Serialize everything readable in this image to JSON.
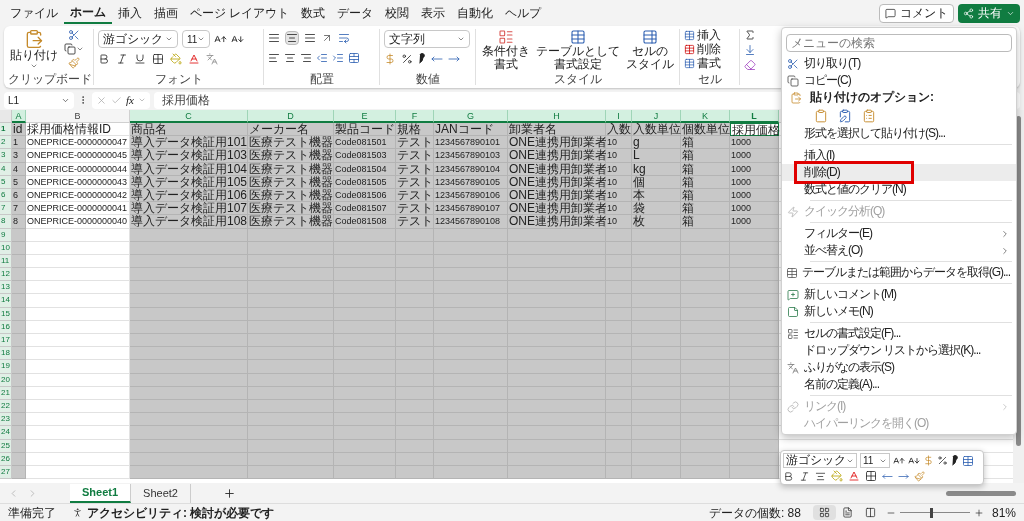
{
  "ribbon_tabs": [
    {
      "label": "ファイル",
      "selected": false
    },
    {
      "label": "ホーム",
      "selected": true
    },
    {
      "label": "挿入",
      "selected": false
    },
    {
      "label": "描画",
      "selected": false
    },
    {
      "label": "ページ レイアウト",
      "selected": false
    },
    {
      "label": "数式",
      "selected": false
    },
    {
      "label": "データ",
      "selected": false
    },
    {
      "label": "校閲",
      "selected": false
    },
    {
      "label": "表示",
      "selected": false
    },
    {
      "label": "自動化",
      "selected": false
    },
    {
      "label": "ヘルプ",
      "selected": false
    }
  ],
  "header_buttons": {
    "comment": "コメント",
    "share": "共有"
  },
  "ribbon": {
    "clipboard": {
      "paste": "貼り付け",
      "label": "クリップボード"
    },
    "font": {
      "name": "游ゴシック",
      "size": "11",
      "label": "フォント"
    },
    "alignment": {
      "label": "配置"
    },
    "number": {
      "format": "文字列",
      "label": "数値"
    },
    "styles": {
      "buttons": [
        [
          "条件付き",
          "書式"
        ],
        [
          "テーブルとして",
          "書式設定"
        ],
        [
          "セルの",
          "スタイル"
        ]
      ],
      "label": "スタイル"
    },
    "cells": {
      "buttons": [
        "挿入",
        "削除",
        "書式"
      ],
      "label": "セル"
    }
  },
  "formula_bar": {
    "name_box": "L1",
    "fx": "fx",
    "content": "採用価格"
  },
  "sheet": {
    "columns": [
      {
        "label": "A",
        "selected": true,
        "active": false
      },
      {
        "label": "B",
        "selected": false,
        "active": false
      },
      {
        "label": "C",
        "selected": true,
        "active": false
      },
      {
        "label": "D",
        "selected": true,
        "active": false
      },
      {
        "label": "E",
        "selected": true,
        "active": false
      },
      {
        "label": "F",
        "selected": true,
        "active": false
      },
      {
        "label": "G",
        "selected": true,
        "active": false
      },
      {
        "label": "H",
        "selected": true,
        "active": false
      },
      {
        "label": "I",
        "selected": true,
        "active": false
      },
      {
        "label": "J",
        "selected": true,
        "active": false
      },
      {
        "label": "K",
        "selected": true,
        "active": false
      },
      {
        "label": "L",
        "selected": true,
        "active": true
      }
    ],
    "rows": [
      {
        "number": "1",
        "active": true,
        "cells": [
          "id",
          "採用価格情報ID",
          "商品名",
          "メーカー名",
          "製品コード",
          "規格",
          "JANコード",
          "卸業者名",
          "入数",
          "入数単位",
          "個数単位",
          "採用価格"
        ]
      },
      {
        "number": "2",
        "active": false,
        "cells": [
          "1",
          "ONEPRICE-0000000047",
          "導入データ検証用101",
          "医療テスト機器",
          "Code081501",
          "テスト",
          "1234567890101",
          "ONE連携用卸業者",
          "10",
          "g",
          "箱",
          "1000"
        ]
      },
      {
        "number": "3",
        "active": false,
        "cells": [
          "3",
          "ONEPRICE-0000000045",
          "導入データ検証用103",
          "医療テスト機器",
          "Code081503",
          "テスト",
          "1234567890103",
          "ONE連携用卸業者",
          "10",
          "L",
          "箱",
          "1000"
        ]
      },
      {
        "number": "4",
        "active": false,
        "cells": [
          "4",
          "ONEPRICE-0000000044",
          "導入データ検証用104",
          "医療テスト機器",
          "Code081504",
          "テスト",
          "1234567890104",
          "ONE連携用卸業者",
          "10",
          "kg",
          "箱",
          "1000"
        ]
      },
      {
        "number": "5",
        "active": false,
        "cells": [
          "5",
          "ONEPRICE-0000000043",
          "導入データ検証用105",
          "医療テスト機器",
          "Code081505",
          "テスト",
          "1234567890105",
          "ONE連携用卸業者",
          "10",
          "個",
          "箱",
          "1000"
        ]
      },
      {
        "number": "6",
        "active": false,
        "cells": [
          "6",
          "ONEPRICE-0000000042",
          "導入データ検証用106",
          "医療テスト機器",
          "Code081506",
          "テスト",
          "1234567890106",
          "ONE連携用卸業者",
          "10",
          "本",
          "箱",
          "1000"
        ]
      },
      {
        "number": "7",
        "active": false,
        "cells": [
          "7",
          "ONEPRICE-0000000041",
          "導入データ検証用107",
          "医療テスト機器",
          "Code081507",
          "テスト",
          "1234567890107",
          "ONE連携用卸業者",
          "10",
          "袋",
          "箱",
          "1000"
        ]
      },
      {
        "number": "8",
        "active": false,
        "cells": [
          "8",
          "ONEPRICE-0000000040",
          "導入データ検証用108",
          "医療テスト機器",
          "Code081508",
          "テスト",
          "1234567890108",
          "ONE連携用卸業者",
          "10",
          "枚",
          "箱",
          "1000"
        ]
      },
      {
        "number": "9",
        "active": false
      },
      {
        "number": "10",
        "active": false
      },
      {
        "number": "11",
        "active": false
      },
      {
        "number": "12",
        "active": false
      },
      {
        "number": "13",
        "active": false
      },
      {
        "number": "14",
        "active": false
      },
      {
        "number": "15",
        "active": false
      },
      {
        "number": "16",
        "active": false
      },
      {
        "number": "17",
        "active": false
      },
      {
        "number": "18",
        "active": false
      },
      {
        "number": "19",
        "active": false
      },
      {
        "number": "20",
        "active": false
      },
      {
        "number": "21",
        "active": false
      },
      {
        "number": "22",
        "active": false
      },
      {
        "number": "23",
        "active": false
      },
      {
        "number": "24",
        "active": false
      },
      {
        "number": "25",
        "active": false
      },
      {
        "number": "26",
        "active": false
      },
      {
        "number": "27",
        "active": false
      }
    ]
  },
  "context_menu": {
    "search_placeholder": "メニューの検索",
    "items": [
      {
        "kind": "item",
        "label": "切り取り(T)",
        "disabled": false,
        "submenu": false,
        "highlighted": false,
        "outlined": false
      },
      {
        "kind": "item",
        "label": "コピー(C)",
        "disabled": false,
        "submenu": false,
        "highlighted": false,
        "outlined": false
      },
      {
        "kind": "header",
        "label": "貼り付けのオプション:"
      },
      {
        "kind": "paste_options"
      },
      {
        "kind": "item",
        "label": "形式を選択して貼り付け(S)...",
        "disabled": false,
        "submenu": false,
        "highlighted": false,
        "outlined": false
      },
      {
        "kind": "separator"
      },
      {
        "kind": "item",
        "label": "挿入(I)",
        "disabled": false,
        "submenu": false,
        "highlighted": false,
        "outlined": false
      },
      {
        "kind": "item",
        "label": "削除(D)",
        "disabled": false,
        "submenu": false,
        "highlighted": true,
        "outlined": true
      },
      {
        "kind": "item",
        "label": "数式と値のクリア(N)",
        "disabled": false,
        "submenu": false,
        "highlighted": false,
        "outlined": false
      },
      {
        "kind": "separator"
      },
      {
        "kind": "item",
        "label": "クイック分析(Q)",
        "disabled": true,
        "submenu": false,
        "highlighted": false,
        "outlined": false
      },
      {
        "kind": "separator"
      },
      {
        "kind": "item",
        "label": "フィルター(E)",
        "disabled": false,
        "submenu": true,
        "highlighted": false,
        "outlined": false
      },
      {
        "kind": "item",
        "label": "並べ替え(O)",
        "disabled": false,
        "submenu": true,
        "highlighted": false,
        "outlined": false
      },
      {
        "kind": "separator"
      },
      {
        "kind": "item",
        "label": "テーブルまたは範囲からデータを取得(G)...",
        "disabled": false,
        "submenu": false,
        "highlighted": false,
        "outlined": false
      },
      {
        "kind": "separator"
      },
      {
        "kind": "item",
        "label": "新しいコメント(M)",
        "disabled": false,
        "submenu": false,
        "highlighted": false,
        "outlined": false
      },
      {
        "kind": "item",
        "label": "新しいメモ(N)",
        "disabled": false,
        "submenu": false,
        "highlighted": false,
        "outlined": false
      },
      {
        "kind": "separator"
      },
      {
        "kind": "item",
        "label": "セルの書式設定(F)...",
        "disabled": false,
        "submenu": false,
        "highlighted": false,
        "outlined": false
      },
      {
        "kind": "item",
        "label": "ドロップダウン リストから選択(K)...",
        "disabled": false,
        "submenu": false,
        "highlighted": false,
        "outlined": false
      },
      {
        "kind": "item",
        "label": "ふりがなの表示(S)",
        "disabled": false,
        "submenu": false,
        "highlighted": false,
        "outlined": false
      },
      {
        "kind": "item",
        "label": "名前の定義(A)...",
        "disabled": false,
        "submenu": false,
        "highlighted": false,
        "outlined": false
      },
      {
        "kind": "separator"
      },
      {
        "kind": "item",
        "label": "リンク(I)",
        "disabled": true,
        "submenu": true,
        "highlighted": false,
        "outlined": false
      },
      {
        "kind": "item",
        "label": "ハイパーリンクを開く(O)",
        "disabled": true,
        "submenu": false,
        "highlighted": false,
        "outlined": false
      }
    ]
  },
  "mini_toolbar": {
    "font": "游ゴシック",
    "size": "11"
  },
  "sheet_tabs": [
    {
      "label": "Sheet1",
      "selected": true
    },
    {
      "label": "Sheet2",
      "selected": false
    }
  ],
  "status_bar": {
    "ready": "準備完了",
    "accessibility": "アクセシビリティ: 検討が必要です",
    "count": "データの個数: 88",
    "zoom": {
      "level": 0.45,
      "reading": "81%"
    }
  }
}
